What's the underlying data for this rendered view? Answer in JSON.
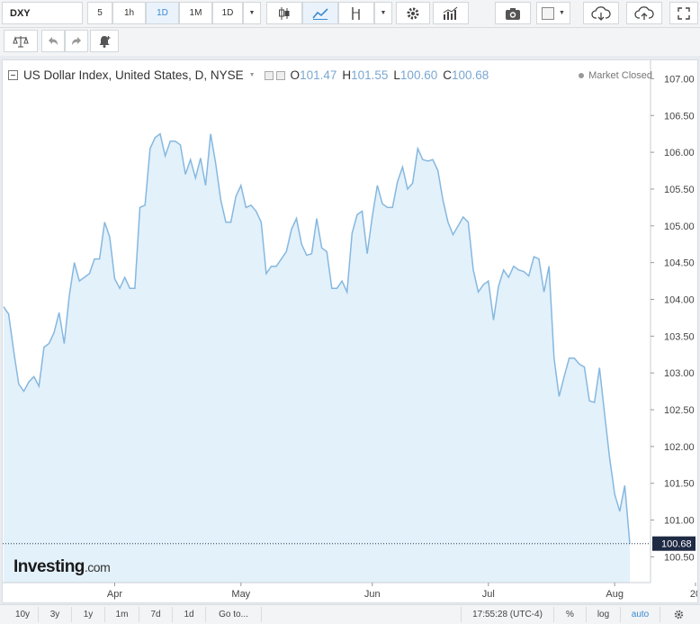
{
  "toolbar": {
    "symbol": "DXY",
    "intervals": [
      "5",
      "1h",
      "1D",
      "1M",
      "1D"
    ],
    "active_interval_index": 2,
    "icons": [
      "candlestick-icon",
      "line-chart-icon",
      "indicator-icon",
      "settings-icon",
      "bar-style-icon",
      "camera-icon",
      "color-square-icon",
      "cloud-download-icon",
      "cloud-upload-icon",
      "fullscreen-icon"
    ]
  },
  "toolbar2": {
    "icons": [
      "scales-icon",
      "undo-icon",
      "redo-icon",
      "alert-bell-icon"
    ]
  },
  "legend": {
    "title": "US Dollar Index, United States, D, NYSE",
    "open_label": "O",
    "open": "101.47",
    "high_label": "H",
    "high": "101.55",
    "low_label": "L",
    "low": "100.60",
    "close_label": "C",
    "close": "100.68"
  },
  "market_status": "Market Closed",
  "logo": {
    "name": "Investing",
    "suffix": ".com"
  },
  "bottombar": {
    "ranges": [
      "10y",
      "3y",
      "1y",
      "1m",
      "7d",
      "1d"
    ],
    "goto": "Go to...",
    "time": "17:55:28 (UTC-4)",
    "percent": "%",
    "log": "log",
    "auto": "auto"
  },
  "colors": {
    "line": "#86b8df",
    "fill": "#e3f1fb",
    "accent": "#3c89d0",
    "last_price_bg": "#1f2a44"
  },
  "chart_data": {
    "type": "area",
    "title": "US Dollar Index, United States, D, NYSE",
    "xlabel": "",
    "ylabel": "",
    "x_tick_labels": [
      "Apr",
      "May",
      "Jun",
      "Jul",
      "Aug",
      "20"
    ],
    "x_tick_index": [
      22,
      47,
      73,
      96,
      121,
      137
    ],
    "y_ticks": [
      100.5,
      101.0,
      101.5,
      102.0,
      102.5,
      103.0,
      103.5,
      104.0,
      104.5,
      105.0,
      105.5,
      106.0,
      106.5,
      107.0
    ],
    "y_tick_labels": [
      "100.50",
      "101.00",
      "101.50",
      "102.00",
      "102.50",
      "103.00",
      "103.50",
      "104.00",
      "104.50",
      "105.00",
      "105.50",
      "106.00",
      "106.50",
      "107.00"
    ],
    "ylim": [
      100.15,
      107.25
    ],
    "last_price": 100.68,
    "last_price_label": "100.68",
    "grid": false,
    "series": [
      {
        "values": [
          103.9,
          103.8,
          103.3,
          102.85,
          102.75,
          102.88,
          102.95,
          102.82,
          103.35,
          103.4,
          103.55,
          103.82,
          103.4,
          104.05,
          104.5,
          104.25,
          104.3,
          104.35,
          104.55,
          104.55,
          105.05,
          104.85,
          104.28,
          104.15,
          104.3,
          104.15,
          104.15,
          105.25,
          105.28,
          106.05,
          106.2,
          106.25,
          105.95,
          106.15,
          106.15,
          106.1,
          105.7,
          105.9,
          105.65,
          105.92,
          105.55,
          106.25,
          105.85,
          105.35,
          105.05,
          105.05,
          105.4,
          105.55,
          105.25,
          105.28,
          105.2,
          105.05,
          104.35,
          104.45,
          104.45,
          104.55,
          104.65,
          104.95,
          105.1,
          104.75,
          104.6,
          104.62,
          105.1,
          104.7,
          104.65,
          104.15,
          104.15,
          104.25,
          104.1,
          104.9,
          105.15,
          105.2,
          104.62,
          105.12,
          105.55,
          105.3,
          105.25,
          105.25,
          105.6,
          105.8,
          105.5,
          105.58,
          106.05,
          105.9,
          105.88,
          105.9,
          105.75,
          105.35,
          105.05,
          104.88,
          105.0,
          105.12,
          105.05,
          104.4,
          104.1,
          104.2,
          104.25,
          103.72,
          104.18,
          104.4,
          104.3,
          104.45,
          104.4,
          104.38,
          104.32,
          104.58,
          104.55,
          104.1,
          104.45,
          103.2,
          102.68,
          102.95,
          103.2,
          103.2,
          103.12,
          103.08,
          102.62,
          102.6,
          103.07,
          102.45,
          101.85,
          101.35,
          101.12,
          101.47,
          100.68
        ]
      }
    ]
  }
}
